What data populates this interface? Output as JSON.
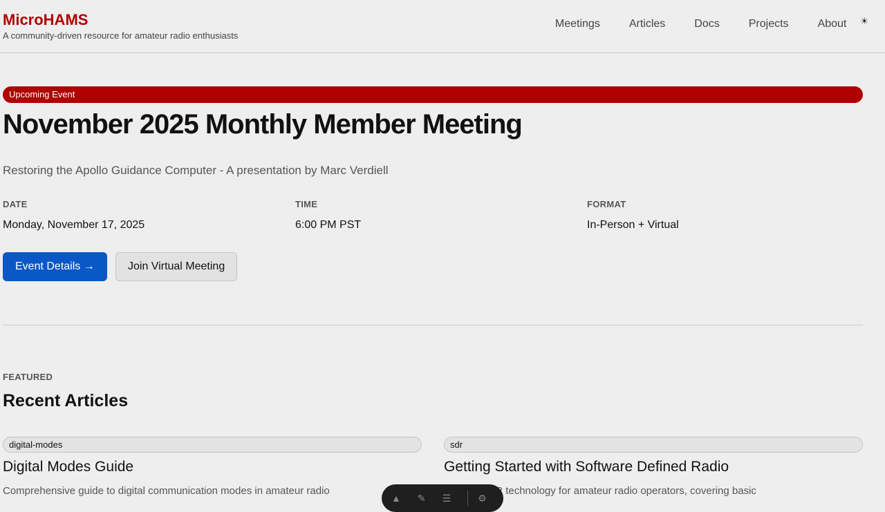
{
  "site": {
    "logo": "MicroHAMS",
    "tagline": "A community-driven resource for amateur radio enthusiasts"
  },
  "nav": {
    "items": [
      {
        "label": "Meetings"
      },
      {
        "label": "Articles"
      },
      {
        "label": "Docs"
      },
      {
        "label": "Projects"
      },
      {
        "label": "About"
      }
    ],
    "theme_icon": "☀"
  },
  "event": {
    "badge": "Upcoming Event",
    "title": "November 2025 Monthly Member Meeting",
    "subtitle": "Restoring the Apollo Guidance Computer - A presentation by Marc Verdiell",
    "date_label": "DATE",
    "date_value": "Monday, November 17, 2025",
    "time_label": "TIME",
    "time_value": "6:00 PM PST",
    "format_label": "FORMAT",
    "format_value": "In-Person + Virtual",
    "details_button": "Event Details →",
    "join_button": "Join Virtual Meeting"
  },
  "articles": {
    "eyebrow": "FEATURED",
    "title": "Recent Articles",
    "items": [
      {
        "tag": "digital-modes",
        "title": "Digital Modes Guide",
        "desc": "Comprehensive guide to digital communication modes in amateur radio"
      },
      {
        "tag": "sdr",
        "title": "Getting Started with Software Defined Radio",
        "desc": "ntion to SDR technology for amateur radio operators, covering basic"
      }
    ]
  },
  "colors": {
    "brand": "#b00000",
    "primary_button": "#0a58c8",
    "background": "#eeeeee"
  }
}
